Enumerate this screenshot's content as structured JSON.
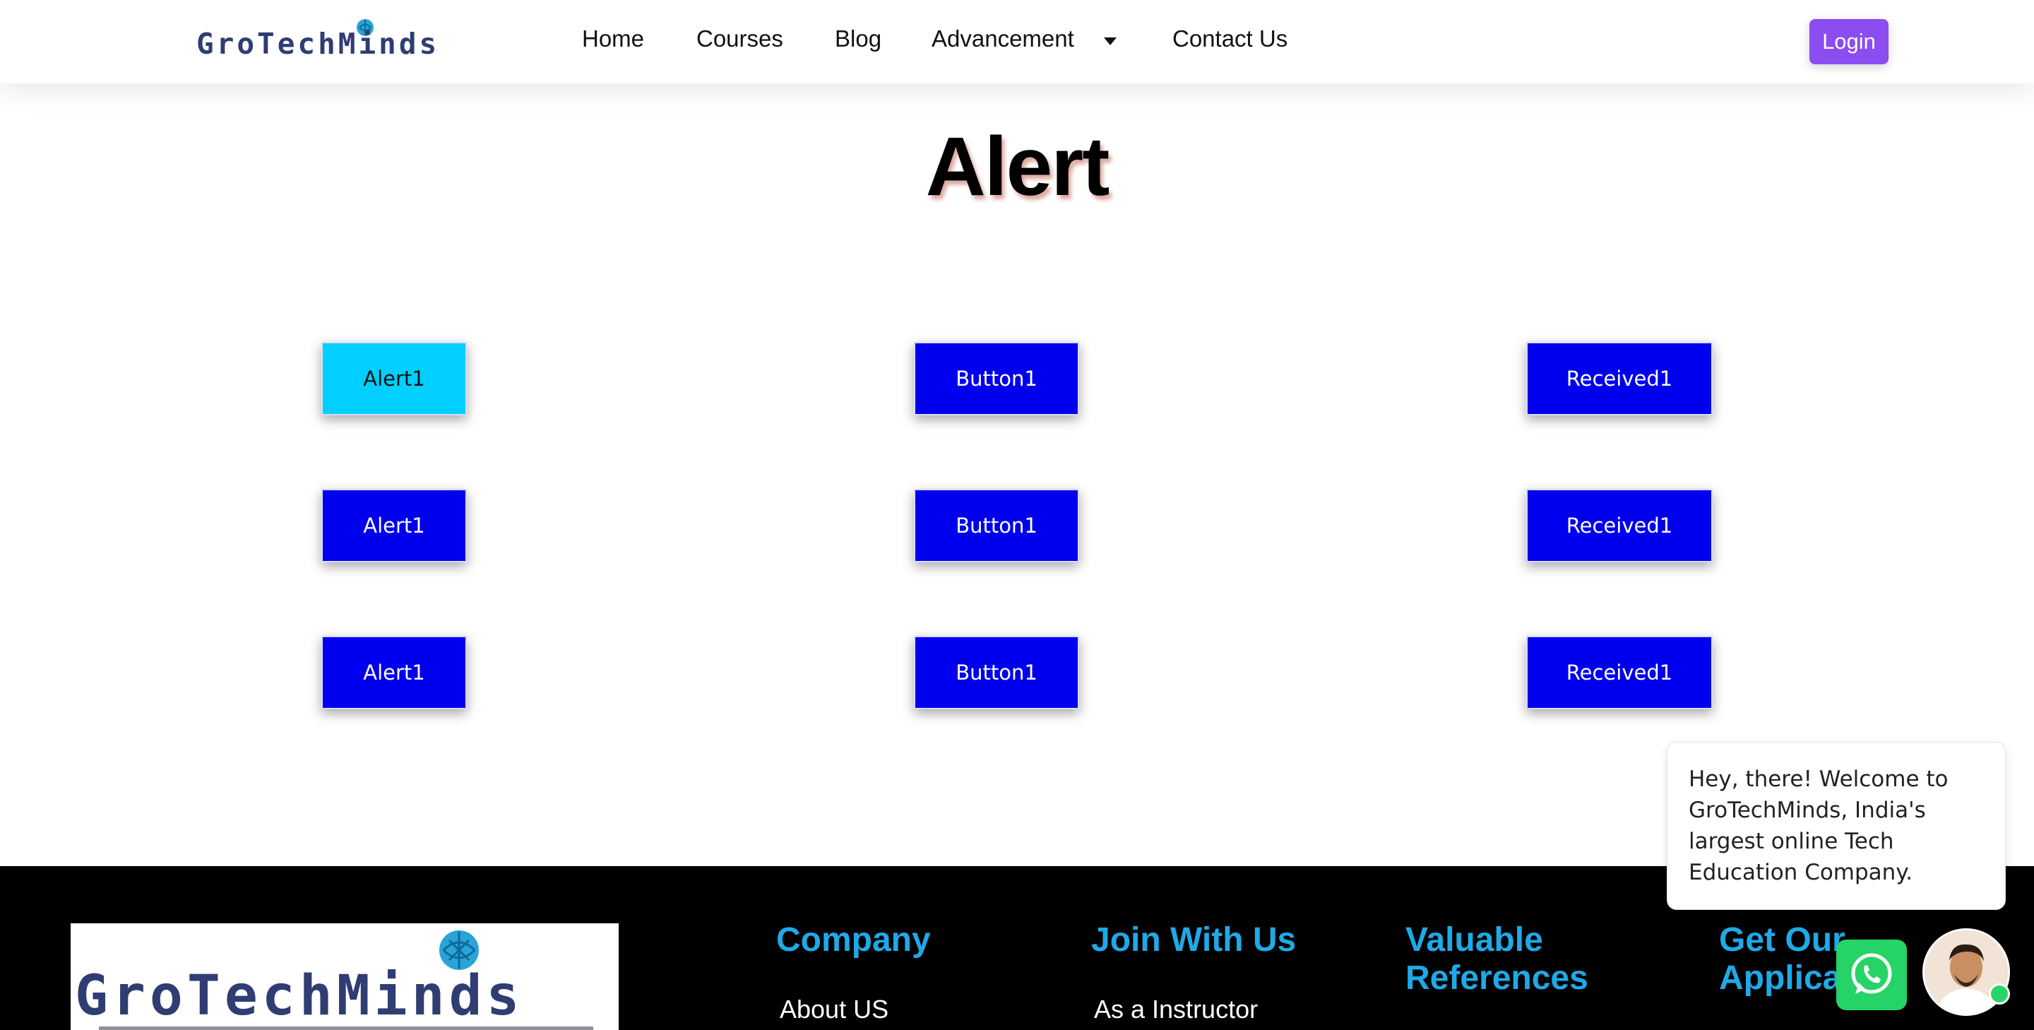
{
  "brand": {
    "name": "GroTechMinds"
  },
  "nav": {
    "items": [
      "Home",
      "Courses",
      "Blog",
      "Advancement",
      "Contact Us"
    ],
    "login_label": "Login"
  },
  "page": {
    "title": "Alert"
  },
  "grid": {
    "rows": [
      [
        "Alert1",
        "Button1",
        "Received1"
      ],
      [
        "Alert1",
        "Button1",
        "Received1"
      ],
      [
        "Alert1",
        "Button1",
        "Received1"
      ]
    ],
    "active_button": "row 1, column 1 (Alert1)",
    "colors": {
      "button_bg": "#0000ee",
      "active_bg": "#00cfff",
      "text": "#ffffff"
    }
  },
  "footer": {
    "logo_text": "GroTechMinds",
    "columns": [
      {
        "heading": "Company",
        "first_item": "About US"
      },
      {
        "heading": "Join With Us",
        "first_item": "As a Instructor"
      },
      {
        "heading": "Valuable References",
        "first_item": ""
      },
      {
        "heading": "Get Our Applica",
        "first_item": ""
      }
    ],
    "heading_color": "#1fa9e6"
  },
  "chat": {
    "message": "Hey, there! Welcome to GroTechMinds, India's largest online Tech Education Company.",
    "whatsapp_icon": "whatsapp-icon",
    "accent": "#25d366"
  }
}
